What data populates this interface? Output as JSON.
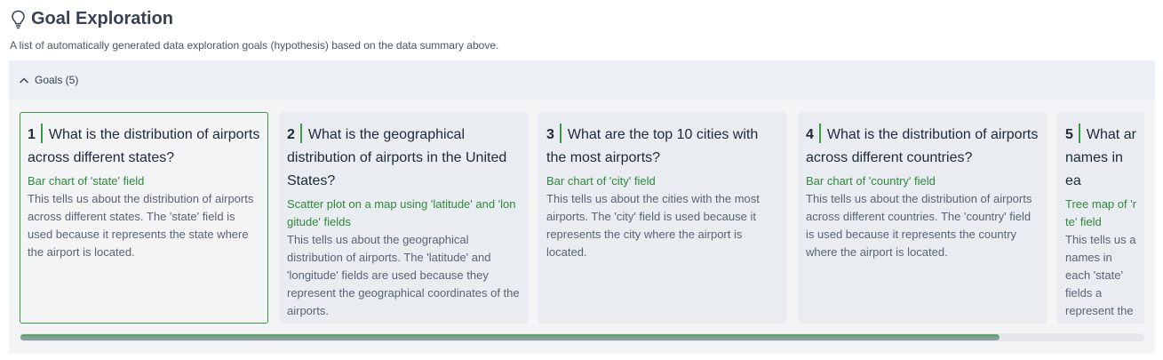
{
  "header": {
    "icon": "lightbulb-icon",
    "title": "Goal Exploration",
    "subtitle": "A list of automatically generated data exploration goals (hypothesis) based on the data summary above."
  },
  "panel": {
    "toggle_icon": "chevron-up-icon",
    "label": "Goals (5)"
  },
  "goals": [
    {
      "index": "1",
      "question": "What is the distribution of airports across different states?",
      "visualization": "Bar chart of 'state' field",
      "rationale": "This tells us about the distribution of airports across different states. The 'state' field is used because it represents the state where the airport is located.",
      "selected": true
    },
    {
      "index": "2",
      "question": "What is the geographical distribution of airports in the United States?",
      "visualization": "Scatter plot on a map using 'latitude' and 'longitude' fields",
      "rationale": "This tells us about the geographical distribution of airports. The 'latitude' and 'longitude' fields are used because they represent the geographical coordinates of the airports."
    },
    {
      "index": "3",
      "question": "What are the top 10 cities with the most airports?",
      "visualization": "Bar chart of 'city' field",
      "rationale": "This tells us about the cities with the most airports. The 'city' field is used because it represents the city where the airport is located."
    },
    {
      "index": "4",
      "question": "What is the distribution of airports across different countries?",
      "visualization": "Bar chart of 'country' field",
      "rationale": "This tells us about the distribution of airports across different countries. The 'country' field is used because it represents the country where the airport is located."
    },
    {
      "index": "5",
      "question": "What ar names in ea",
      "visualization": "Tree map of 'r te' field",
      "rationale": "This tells us a names in each 'state' fields a represent the the state whe respectively."
    }
  ],
  "colors": {
    "accent_green": "#3a9a4a",
    "viz_text_green": "#2f8a3a",
    "card_bg": "#e9ecf1"
  }
}
